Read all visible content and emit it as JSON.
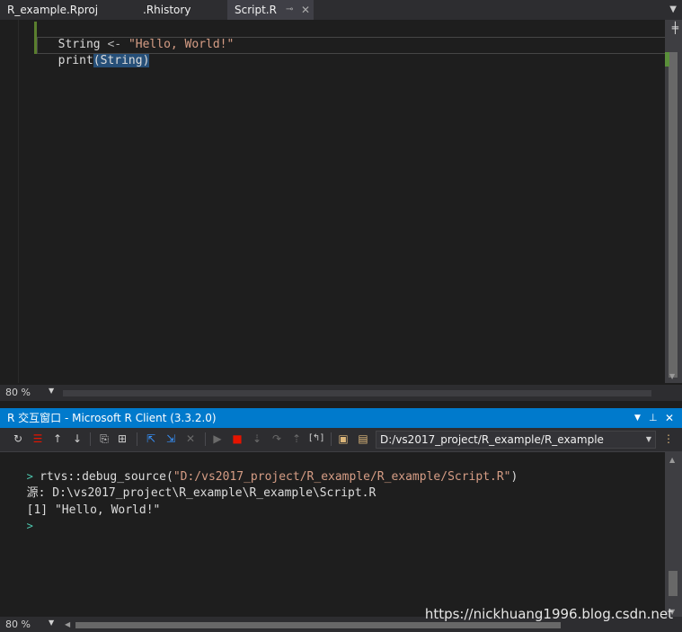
{
  "tabs": [
    {
      "label": "R_example.Rproj"
    },
    {
      "label": ".Rhistory"
    },
    {
      "label": "Script.R"
    }
  ],
  "icons": {
    "pin": "pin-icon",
    "close": "close-icon",
    "dropdown": "chevron-down-icon",
    "split": "split-icon"
  },
  "editor": {
    "line1": {
      "var": "String",
      "op": " <- ",
      "str": "\"Hello, World!\""
    },
    "line2": {
      "fn": "print",
      "arg": "(String)"
    },
    "zoom": "80 %"
  },
  "panel": {
    "title": "R 交互窗口 - Microsoft R Client (3.3.2.0)",
    "working_dir": "D:/vs2017_project/R_example/R_example"
  },
  "console": {
    "zoom": "80 %",
    "prompt": "> ",
    "cmd_prefix": "rtvs::debug_source(",
    "cmd_str": "\"D:/vs2017_project/R_example/R_example/Script.R\"",
    "cmd_suffix": ")",
    "line2": "源: D:\\vs2017_project\\R_example\\R_example\\Script.R",
    "line3": "[1] \"Hello, World!\"",
    "empty_prompt": ">"
  },
  "watermark": "https://nickhuang1996.blog.csdn.net",
  "colors": {
    "accent": "#007acc",
    "string": "#d69d85",
    "prompt": "#4ec9b0",
    "selection": "#264f78"
  }
}
